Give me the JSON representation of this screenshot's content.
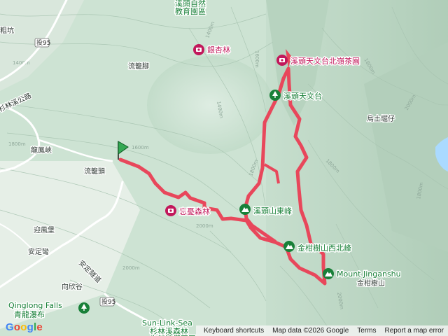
{
  "map": {
    "colors": {
      "route": "#e8475b",
      "poi": "#c2185b",
      "park": "#188038",
      "water": "#aadaff",
      "road": "#ffffff"
    },
    "place_labels": [
      {
        "id": "zhukeng",
        "text": "粗坑"
      },
      {
        "id": "liulongjiao",
        "text": "流籠腳"
      },
      {
        "id": "shanlinxi-road",
        "text": "杉林溪公路"
      },
      {
        "id": "longfengxia",
        "text": "龍鳳峽"
      },
      {
        "id": "liulongtou",
        "text": "流籠頭"
      },
      {
        "id": "yingfengbao",
        "text": "迎風堡"
      },
      {
        "id": "andingwan",
        "text": "安定彎"
      },
      {
        "id": "andingsuidao",
        "text": "安定隧道"
      },
      {
        "id": "xiangxingu",
        "text": "向欣谷"
      },
      {
        "id": "wutuciai",
        "text": "烏土堀仔"
      },
      {
        "id": "jinganshu-zh",
        "text": "金柑樹山"
      }
    ],
    "pois": [
      {
        "id": "xitou-edu",
        "text": "溪頭自然\n教育園區",
        "kind": "park"
      },
      {
        "id": "ginkgo",
        "text": "銀杏林",
        "kind": "attraction"
      },
      {
        "id": "tea-garden",
        "text": "溪頭天文台北嶺茶園",
        "kind": "attraction"
      },
      {
        "id": "observatory",
        "text": "溪頭天文台",
        "kind": "park"
      },
      {
        "id": "wangyou",
        "text": "忘憂森林",
        "kind": "attraction"
      },
      {
        "id": "xitoushan-east",
        "text": "溪頭山東峰",
        "kind": "peak"
      },
      {
        "id": "jingan-nw",
        "text": "金柑樹山西北峰",
        "kind": "peak"
      },
      {
        "id": "mount-jinganshu",
        "text": "Mount Jinganshu",
        "kind": "peak"
      },
      {
        "id": "qinglong",
        "text": "Qinglong Falls",
        "kind": "park"
      },
      {
        "id": "qinglong-zh",
        "text": "青龍瀑布",
        "kind": "park"
      },
      {
        "id": "sunlinksea",
        "text": "Sun-Link-Sea",
        "kind": "park"
      },
      {
        "id": "sunlinksea-zh",
        "text": "杉林溪森林\n生態渡假園區",
        "kind": "park"
      }
    ],
    "road_shields": [
      "投95",
      "投95"
    ],
    "contour_labels": [
      "1400m",
      "1600m",
      "1800m",
      "2000m",
      "1600m",
      "1800m",
      "1400m",
      "1800m",
      "2000m",
      "2000m",
      "1800m",
      "1800m",
      "1400m",
      "2000m"
    ]
  },
  "footer": {
    "shortcuts": "Keyboard shortcuts",
    "mapdata": "Map data ©2026 Google",
    "terms": "Terms",
    "report": "Report a map error"
  },
  "logo": "Google"
}
